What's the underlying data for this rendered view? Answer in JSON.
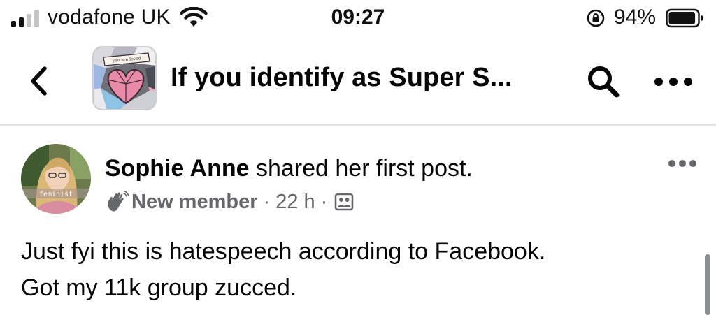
{
  "status_bar": {
    "carrier": "vodafone UK",
    "time": "09:27",
    "battery_percent": "94%",
    "battery_level": 0.94,
    "signal_bars": 2,
    "signal_bars_total": 4,
    "icons": [
      "signal-icon",
      "wifi-icon",
      "orientation-lock-icon",
      "battery-icon"
    ]
  },
  "header": {
    "title": "If you identify as Super S...",
    "avatar_banner_text": "you are loved",
    "icons": [
      "back-chevron-icon",
      "search-icon",
      "more-dots-icon"
    ]
  },
  "post": {
    "author": "Sophie Anne",
    "action_text": " shared her first post.",
    "avatar_caption": "feminist",
    "member_badge": "New member",
    "separator": "·",
    "time": "22 h",
    "icons": [
      "new-member-wave-icon",
      "audience-group-icon",
      "post-more-icon"
    ],
    "text_lines": [
      "Just fyi this is hatespeech according to Facebook.",
      "Got my 11k group zucced."
    ]
  },
  "colors": {
    "primary_text": "#050505",
    "secondary_text": "#65676b",
    "divider": "#e4e6eb",
    "heart_pink": "#e88aa8"
  }
}
